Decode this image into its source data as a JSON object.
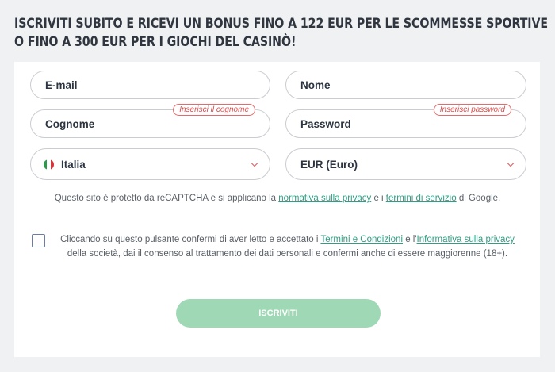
{
  "headline": {
    "line1": "ISCRIVITI SUBITO E RICEVI UN BONUS FINO A 122 EUR PER LE SCOMMESSE SPORTIVE",
    "line2": "O FINO A 300 EUR PER I GIOCHI DEL CASINÒ!"
  },
  "form": {
    "email_placeholder": "E-mail",
    "name_placeholder": "Nome",
    "surname_placeholder": "Cognome",
    "surname_error": "Inserisci il cognome",
    "password_placeholder": "Password",
    "password_error": "Inserisci password",
    "country_value": "Italia",
    "country_flag_icon": "italy-flag-icon",
    "currency_value": "EUR (Euro)",
    "submit_label": "ISCRIVITI"
  },
  "captcha": {
    "text_before": "Questo sito è protetto da reCAPTCHA e si applicano la ",
    "privacy_link": "normativa sulla privacy",
    "text_middle": " e i ",
    "terms_link": "termini di servizio",
    "text_after": " di Google."
  },
  "consent": {
    "text_before": "Cliccando su questo pulsante confermi di aver letto e accettato i ",
    "terms_link": "Termini e Condizioni",
    "text_middle": " e l'",
    "privacy_link": "Informativa sulla privacy",
    "text_after": " della società, dai il consenso al trattamento dei dati personali e confermi anche di essere maggiorenne (18+).",
    "checked": false
  },
  "colors": {
    "accent_green": "#2e9f84",
    "button_green": "#9fd8b5",
    "error_red": "#e14a4a"
  }
}
